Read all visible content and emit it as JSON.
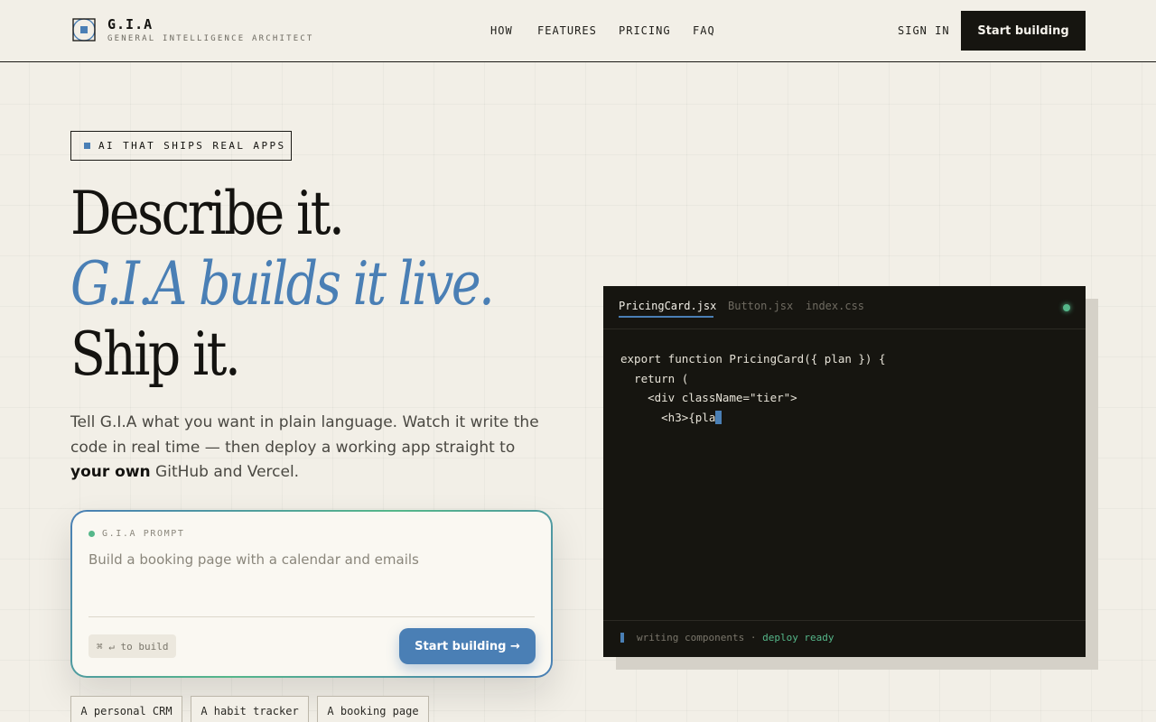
{
  "nav": {
    "brand_name": "G.I.A",
    "brand_tagline": "GENERAL INTELLIGENCE ARCHITECT",
    "links": [
      "HOW",
      "FEATURES",
      "PRICING",
      "FAQ"
    ],
    "sign_in": "SIGN IN",
    "cta": "Start building"
  },
  "hero": {
    "badge": "AI THAT SHIPS REAL APPS",
    "headline_1": "Describe it.",
    "headline_2": "G.I.A builds it live.",
    "headline_3": "Ship it.",
    "lead_before": "Tell G.I.A what you want in plain language. Watch it write the code in real time — then deploy a working app straight to ",
    "lead_bold": "your own",
    "lead_after": " GitHub and Vercel."
  },
  "prompt": {
    "label": "G.I.A PROMPT",
    "placeholder": "Build a booking page with a calendar and emails",
    "shortcut": "⌘ ↵ to build",
    "submit": "Start building →"
  },
  "examples": [
    "A personal CRM",
    "A habit tracker",
    "A booking page"
  ],
  "editor": {
    "tabs": [
      "PricingCard.jsx",
      "Button.jsx",
      "index.css"
    ],
    "active_tab": "PricingCard.jsx",
    "code_lines": [
      "export function PricingCard({ plan }) {",
      "  return (",
      "    <div className=\"tier\">",
      "      <h3>{pla"
    ],
    "status_text": "writing components · ",
    "status_ok": "deploy ready"
  },
  "colors": {
    "accent": "#4a7fb5",
    "success": "#55b78a",
    "ink": "#141310",
    "paper": "#f2efe7"
  }
}
